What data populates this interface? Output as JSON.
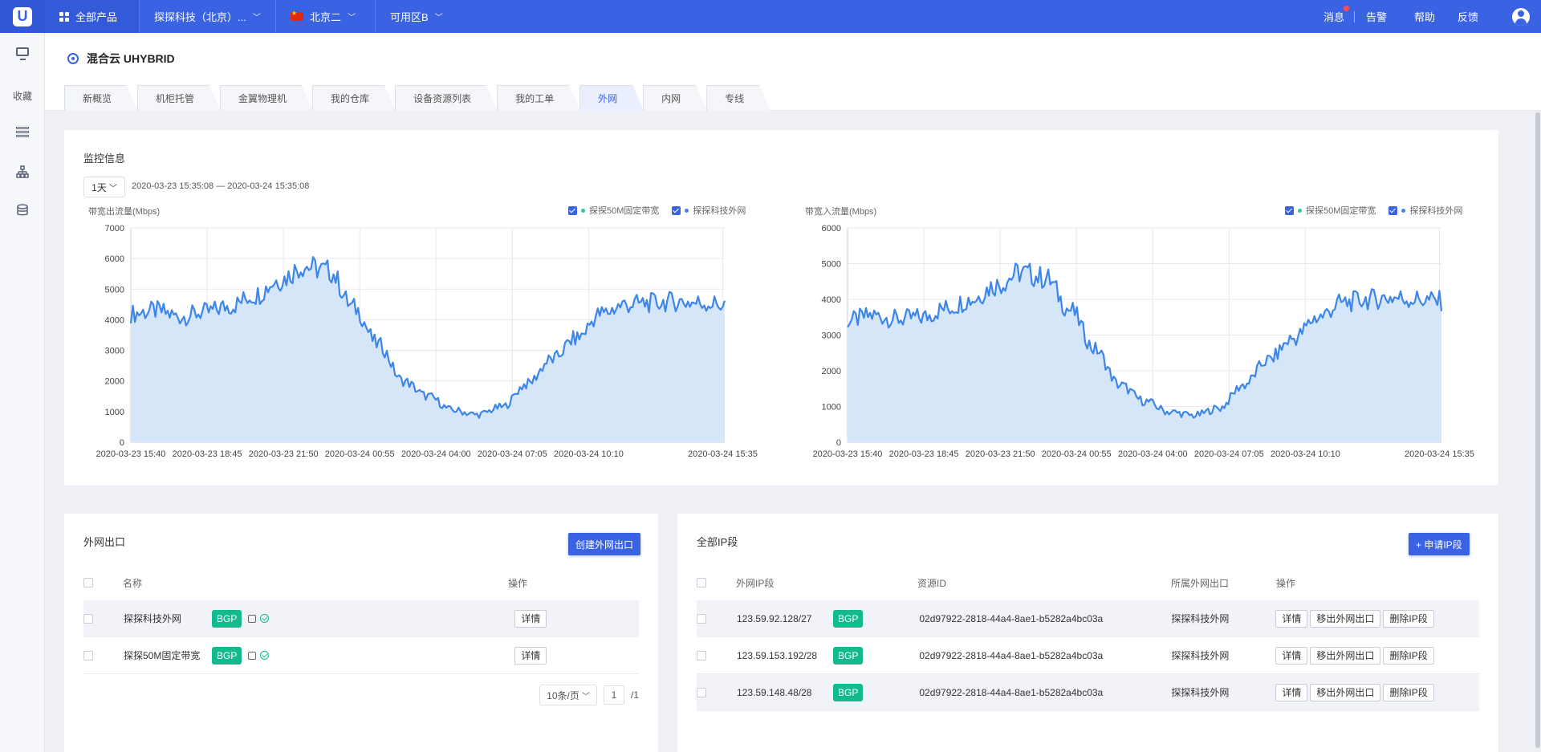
{
  "topbar": {
    "logo": "U",
    "products": "全部产品",
    "company": "探探科技（北京）...",
    "region": "北京二",
    "zone": "可用区B",
    "links": [
      "消息",
      "告警",
      "帮助",
      "反馈"
    ]
  },
  "sidebar": {
    "favorites": "收藏"
  },
  "header": {
    "title": "混合云 UHYBRID",
    "tabs": [
      "新概览",
      "机柜托管",
      "金翼物理机",
      "我的仓库",
      "设备资源列表",
      "我的工单",
      "外网",
      "内网",
      "专线"
    ],
    "active_tab": "外网"
  },
  "monitor": {
    "title": "监控信息",
    "range": "1天",
    "time_range": "2020-03-23 15:35:08 — 2020-03-24 15:35:08"
  },
  "colors": {
    "accent": "#3a63e4",
    "series_fixed": "#2fc4a5",
    "series_external": "#3d86e8",
    "area_fill": "#d4e6f8",
    "bgp": "#14b98d"
  },
  "chart_data": [
    {
      "type": "line",
      "ylabel": "带宽出流量(Mbps)",
      "ylim": [
        0,
        7000
      ],
      "yticks": [
        0,
        1000,
        2000,
        3000,
        4000,
        5000,
        6000,
        7000
      ],
      "x_tick_labels": [
        "2020-03-23 15:40",
        "2020-03-23 18:45",
        "2020-03-23 21:50",
        "2020-03-24 00:55",
        "2020-03-24 04:00",
        "2020-03-24 07:05",
        "2020-03-24 10:10",
        "2020-03-24 15:35"
      ],
      "x_tick_positions_hours": [
        0,
        3.083,
        6.167,
        9.25,
        12.333,
        15.417,
        18.5,
        23.917
      ],
      "legend_position": "top-right",
      "grid": true,
      "series": [
        {
          "name": "探探50M固定带宽",
          "color": "#2fc4a5",
          "x_hours": [
            0,
            24
          ],
          "values": [
            20,
            20
          ]
        },
        {
          "name": "探探科技外网",
          "color": "#3d86e8",
          "fill": true,
          "x_hours": [
            0,
            1,
            2,
            3,
            4,
            5,
            6,
            7,
            8,
            9,
            10,
            11,
            12,
            13,
            14,
            15,
            16,
            17,
            18,
            19,
            20,
            21,
            22,
            23,
            24
          ],
          "values": [
            4200,
            4300,
            4100,
            4250,
            4450,
            4800,
            5300,
            5750,
            5600,
            4400,
            3200,
            2000,
            1500,
            1050,
            900,
            1150,
            1900,
            2700,
            3400,
            4200,
            4500,
            4550,
            4600,
            4550,
            4500
          ]
        }
      ]
    },
    {
      "type": "line",
      "ylabel": "带宽入流量(Mbps)",
      "ylim": [
        0,
        6000
      ],
      "yticks": [
        0,
        1000,
        2000,
        3000,
        4000,
        5000,
        6000
      ],
      "x_tick_labels": [
        "2020-03-23 15:40",
        "2020-03-23 18:45",
        "2020-03-23 21:50",
        "2020-03-24 00:55",
        "2020-03-24 04:00",
        "2020-03-24 07:05",
        "2020-03-24 10:10",
        "2020-03-24 15:35"
      ],
      "x_tick_positions_hours": [
        0,
        3.083,
        6.167,
        9.25,
        12.333,
        15.417,
        18.5,
        23.917
      ],
      "legend_position": "top-right",
      "grid": true,
      "series": [
        {
          "name": "探探50M固定带宽",
          "color": "#2fc4a5",
          "x_hours": [
            0,
            24
          ],
          "values": [
            20,
            20
          ]
        },
        {
          "name": "探探科技外网",
          "color": "#3d86e8",
          "fill": true,
          "x_hours": [
            0,
            1,
            2,
            3,
            4,
            5,
            6,
            7,
            8,
            9,
            10,
            11,
            12,
            13,
            14,
            15,
            16,
            17,
            18,
            19,
            20,
            21,
            22,
            23,
            24
          ],
          "values": [
            3400,
            3550,
            3450,
            3500,
            3750,
            4000,
            4400,
            4750,
            4600,
            3700,
            2600,
            1600,
            1150,
            850,
            750,
            950,
            1600,
            2300,
            2900,
            3500,
            3900,
            4000,
            4050,
            4000,
            3950
          ]
        }
      ]
    }
  ],
  "exits": {
    "title": "外网出口",
    "create_button": "创建外网出口",
    "columns": [
      "名称",
      "操作"
    ],
    "rows": [
      {
        "name": "探探科技外网",
        "tag": "BGP",
        "action": "详情"
      },
      {
        "name": "探探50M固定带宽",
        "tag": "BGP",
        "action": "详情"
      }
    ],
    "pager": {
      "size": "10条/页",
      "page": "1",
      "total": "/1"
    }
  },
  "ips": {
    "title": "全部IP段",
    "apply_button": "+ 申请IP段",
    "columns": [
      "外网IP段",
      "资源ID",
      "所属外网出口",
      "操作"
    ],
    "rows": [
      {
        "ip": "123.59.92.128/27",
        "tag": "BGP",
        "id": "02d97922-2818-44a4-8ae1-b5282a4bc03a",
        "exit": "探探科技外网"
      },
      {
        "ip": "123.59.153.192/28",
        "tag": "BGP",
        "id": "02d97922-2818-44a4-8ae1-b5282a4bc03a",
        "exit": "探探科技外网"
      },
      {
        "ip": "123.59.148.48/28",
        "tag": "BGP",
        "id": "02d97922-2818-44a4-8ae1-b5282a4bc03a",
        "exit": "探探科技外网"
      }
    ],
    "actions": [
      "详情",
      "移出外网出口",
      "删除IP段"
    ]
  }
}
